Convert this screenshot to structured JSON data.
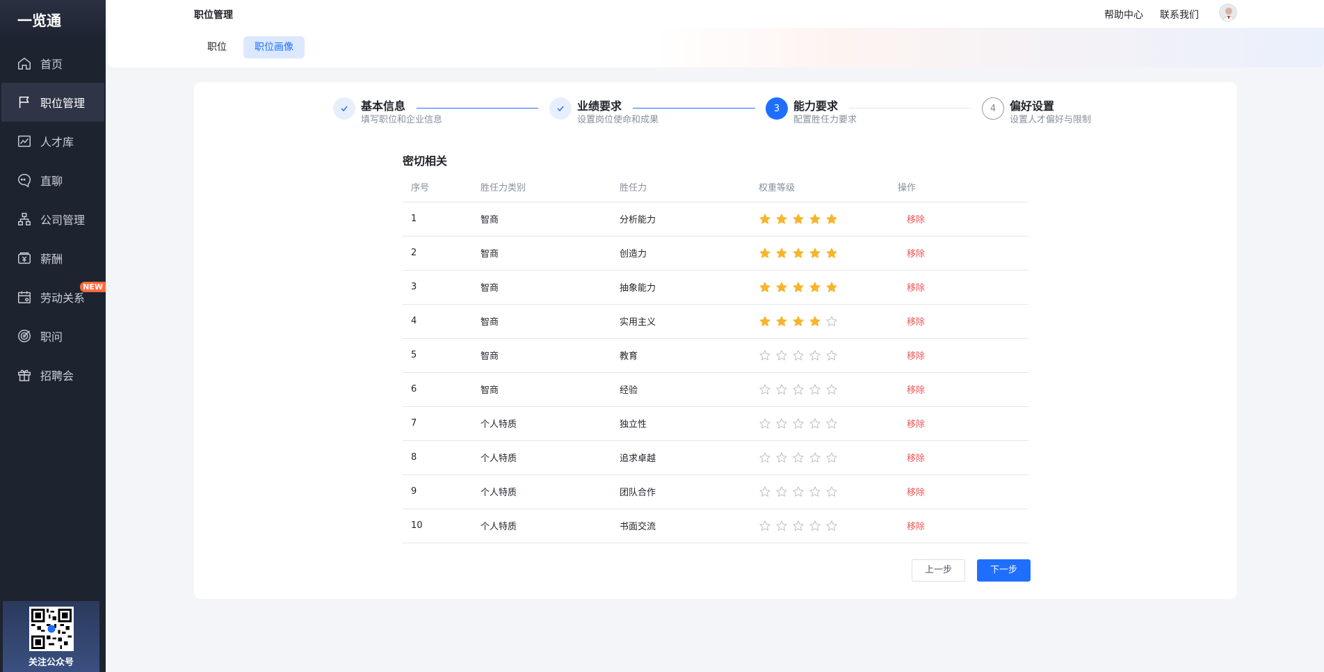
{
  "sidebar": {
    "logo": "一览通",
    "items": [
      {
        "label": "首页",
        "icon": "home-icon"
      },
      {
        "label": "职位管理",
        "icon": "flag-icon",
        "active": true
      },
      {
        "label": "人才库",
        "icon": "chart-icon"
      },
      {
        "label": "直聊",
        "icon": "chat-icon"
      },
      {
        "label": "公司管理",
        "icon": "org-icon"
      },
      {
        "label": "薪酬",
        "icon": "salary-icon"
      },
      {
        "label": "劳动关系",
        "icon": "calendar-icon",
        "badge": "NEW"
      },
      {
        "label": "职问",
        "icon": "target-icon"
      },
      {
        "label": "招聘会",
        "icon": "gift-icon"
      }
    ],
    "qr_label": "关注公众号"
  },
  "header": {
    "title": "职位管理",
    "links": [
      "帮助中心",
      "联系我们"
    ]
  },
  "tabs": [
    {
      "label": "职位",
      "active": false
    },
    {
      "label": "职位画像",
      "active": true
    }
  ],
  "steps": [
    {
      "num": "1",
      "title": "基本信息",
      "sub": "填写职位和企业信息",
      "state": "done"
    },
    {
      "num": "2",
      "title": "业绩要求",
      "sub": "设置岗位使命和成果",
      "state": "done"
    },
    {
      "num": "3",
      "title": "能力要求",
      "sub": "配置胜任力要求",
      "state": "active"
    },
    {
      "num": "4",
      "title": "偏好设置",
      "sub": "设置人才偏好与限制",
      "state": "wait"
    }
  ],
  "section_title": "密切相关",
  "table": {
    "headers": [
      "序号",
      "胜任力类别",
      "胜任力",
      "权重等级",
      "操作"
    ],
    "remove_label": "移除",
    "rows": [
      {
        "idx": "1",
        "category": "智商",
        "competency": "分析能力",
        "stars": 5
      },
      {
        "idx": "2",
        "category": "智商",
        "competency": "创造力",
        "stars": 5
      },
      {
        "idx": "3",
        "category": "智商",
        "competency": "抽象能力",
        "stars": 5
      },
      {
        "idx": "4",
        "category": "智商",
        "competency": "实用主义",
        "stars": 4
      },
      {
        "idx": "5",
        "category": "智商",
        "competency": "教育",
        "stars": 0
      },
      {
        "idx": "6",
        "category": "智商",
        "competency": "经验",
        "stars": 0
      },
      {
        "idx": "7",
        "category": "个人特质",
        "competency": "独立性",
        "stars": 0
      },
      {
        "idx": "8",
        "category": "个人特质",
        "competency": "追求卓越",
        "stars": 0
      },
      {
        "idx": "9",
        "category": "个人特质",
        "competency": "团队合作",
        "stars": 0
      },
      {
        "idx": "10",
        "category": "个人特质",
        "competency": "书面交流",
        "stars": 0
      }
    ]
  },
  "buttons": {
    "prev": "上一步",
    "next": "下一步"
  },
  "colors": {
    "primary": "#1f6fff",
    "star": "#f7b52c",
    "danger": "#f05454",
    "sidebar": "#1e2330"
  }
}
